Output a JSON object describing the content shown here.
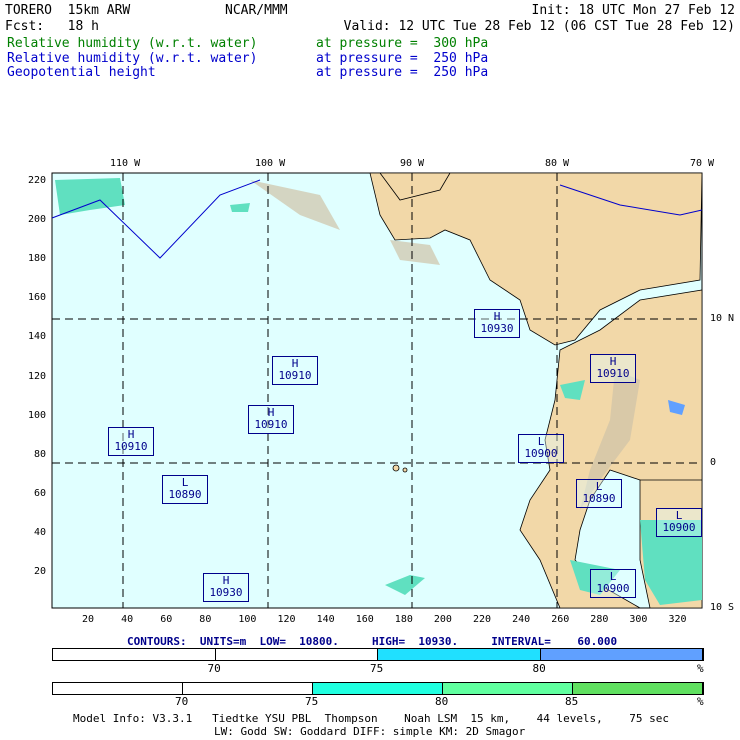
{
  "header": {
    "model": "TORERO  15km ARW",
    "org": "NCAR/MMM",
    "init": "Init: 18 UTC Mon 27 Feb 12",
    "fcst": "Fcst:   18 h",
    "valid": "Valid: 12 UTC Tue 28 Feb 12 (06 CST Tue 28 Feb 12)",
    "fields": [
      {
        "name": "Relative humidity (w.r.t. water)",
        "level": "at pressure =  300 hPa",
        "color": "#008000"
      },
      {
        "name": "Relative humidity (w.r.t. water)",
        "level": "at pressure =  250 hPa",
        "color": "#0000cc"
      },
      {
        "name": "Geopotential height",
        "level": "at pressure =  250 hPa",
        "color": "#0000cc"
      }
    ]
  },
  "axes": {
    "top": [
      "110 W",
      "100 W",
      "90 W",
      "80 W",
      "70 W"
    ],
    "right": [
      "10 N",
      "0",
      "10 S"
    ],
    "left": [
      "220",
      "200",
      "180",
      "160",
      "140",
      "120",
      "100",
      "80",
      "60",
      "40",
      "20"
    ],
    "bottom": [
      "20",
      "40",
      "60",
      "80",
      "100",
      "120",
      "140",
      "160",
      "180",
      "200",
      "220",
      "240",
      "260",
      "280",
      "300",
      "320"
    ]
  },
  "centers": [
    {
      "type": "H",
      "value": "10930"
    },
    {
      "type": "H",
      "value": "10910"
    },
    {
      "type": "H",
      "value": "10910"
    },
    {
      "type": "H",
      "value": "10910"
    },
    {
      "type": "L",
      "value": "10890"
    },
    {
      "type": "H",
      "value": "10930"
    },
    {
      "type": "H",
      "value": "10910"
    },
    {
      "type": "L",
      "value": "10900"
    },
    {
      "type": "L",
      "value": "10890"
    },
    {
      "type": "L",
      "value": "10900"
    },
    {
      "type": "L",
      "value": "10900"
    }
  ],
  "contours": "CONTOURS:  UNITS=m  LOW=  10800.     HIGH=  10930.     INTERVAL=    60.000",
  "colorbar1": {
    "labels": [
      "70",
      "75",
      "80",
      "%"
    ],
    "colors": [
      "#ffffff",
      "#ffffff",
      "#20e0ff",
      "#60a0ff"
    ]
  },
  "colorbar2": {
    "labels": [
      "70",
      "75",
      "80",
      "85",
      "%"
    ],
    "colors": [
      "#ffffff",
      "#ffffff",
      "#20ffe0",
      "#60ff9f",
      "#60e060"
    ]
  },
  "footer": {
    "line1": "Model Info: V3.3.1   Tiedtke YSU PBL  Thompson    Noah LSM  15 km,    44 levels,    75 sec",
    "line2": "LW: Godd SW: Goddard DIFF: simple KM: 2D Smagor"
  }
}
